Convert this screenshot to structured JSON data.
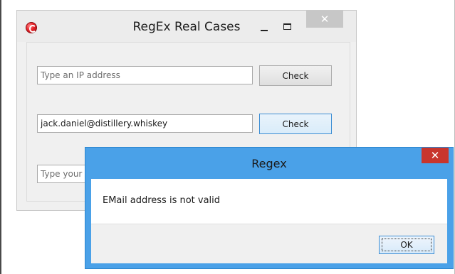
{
  "main_window": {
    "title": "RegEx Real Cases",
    "ip_input": {
      "value": "",
      "placeholder": "Type an IP address"
    },
    "ip_check_label": "Check",
    "email_input": {
      "value": "jack.daniel@distillery.whiskey",
      "placeholder": ""
    },
    "email_check_label": "Check",
    "third_input": {
      "value": "",
      "placeholder": "Type your"
    },
    "close_glyph": "✕"
  },
  "dialog": {
    "title": "Regex",
    "message": "EMail address is not valid",
    "ok_label": "OK",
    "close_glyph": "✕"
  },
  "colors": {
    "dialog_frame": "#4aa1e8",
    "dialog_close": "#c8352d",
    "main_close": "#c7c7c7"
  }
}
